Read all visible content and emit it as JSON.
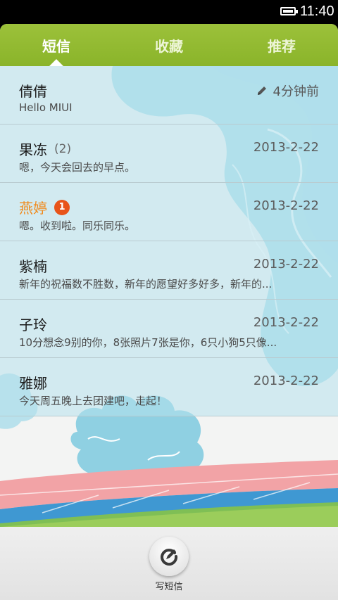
{
  "status": {
    "time": "11:40"
  },
  "tabs": [
    {
      "label": "短信",
      "active": true
    },
    {
      "label": "收藏",
      "active": false
    },
    {
      "label": "推荐",
      "active": false
    }
  ],
  "messages": [
    {
      "name": "倩倩",
      "count": "",
      "badge": "",
      "date": "4分钟前",
      "draft": true,
      "preview": "Hello MIUI",
      "unread": false
    },
    {
      "name": "果冻",
      "count": "(2)",
      "badge": "",
      "date": "2013-2-22",
      "draft": false,
      "preview": "嗯，今天会回去的早点。",
      "unread": false
    },
    {
      "name": "燕婷",
      "count": "",
      "badge": "1",
      "date": "2013-2-22",
      "draft": false,
      "preview": "嗯。收到啦。同乐同乐。",
      "unread": true
    },
    {
      "name": "紫楠",
      "count": "",
      "badge": "",
      "date": "2013-2-22",
      "draft": false,
      "preview": "新年的祝福数不胜数，新年的愿望好多好多，新年的...",
      "unread": false
    },
    {
      "name": "子玲",
      "count": "",
      "badge": "",
      "date": "2013-2-22",
      "draft": false,
      "preview": "10分想念9别的你，8张照片7张是你，6只小狗5只像...",
      "unread": false
    },
    {
      "name": "雅娜",
      "count": "",
      "badge": "",
      "date": "2013-2-22",
      "draft": false,
      "preview": "今天周五晚上去团建吧，走起！",
      "unread": false
    }
  ],
  "compose": {
    "label": "写短信"
  },
  "colors": {
    "accent": "#8ab42a",
    "unread": "#f08a1c",
    "badge": "#e8541a"
  }
}
